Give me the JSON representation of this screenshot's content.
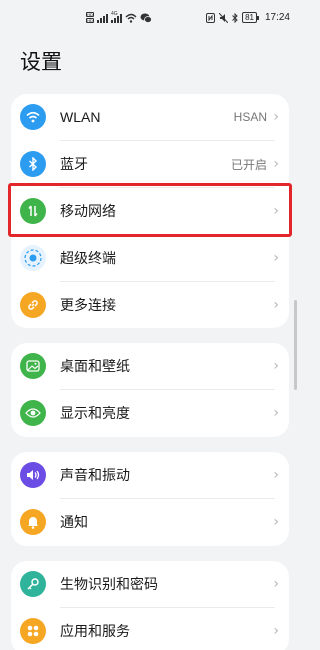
{
  "status_bar": {
    "sim1": "HD",
    "sim2": "HD",
    "net_tag": "4G",
    "battery": "81",
    "time": "17:24"
  },
  "page": {
    "title": "设置"
  },
  "settings": [
    {
      "label": "WLAN",
      "value": "HSAN",
      "icon": "wifi-icon",
      "color": "#2b9cf0"
    },
    {
      "label": "蓝牙",
      "value": "已开启",
      "icon": "bluetooth-icon",
      "color": "#2b9cf0"
    },
    {
      "label": "移动网络",
      "value": "",
      "icon": "mobile-data-icon",
      "color": "#3fb44a"
    },
    {
      "label": "超级终端",
      "value": "",
      "icon": "super-device-icon",
      "color": "#2b9cf0"
    },
    {
      "label": "更多连接",
      "value": "",
      "icon": "link-icon",
      "color": "#f5a623"
    },
    {
      "label": "桌面和壁纸",
      "value": "",
      "icon": "wallpaper-icon",
      "color": "#3fb44a"
    },
    {
      "label": "显示和亮度",
      "value": "",
      "icon": "eye-icon",
      "color": "#3fb44a"
    },
    {
      "label": "声音和振动",
      "value": "",
      "icon": "sound-icon",
      "color": "#6b4de6"
    },
    {
      "label": "通知",
      "value": "",
      "icon": "bell-icon",
      "color": "#f5a623"
    },
    {
      "label": "生物识别和密码",
      "value": "",
      "icon": "key-icon",
      "color": "#2fb39a"
    },
    {
      "label": "应用和服务",
      "value": "",
      "icon": "apps-icon",
      "color": "#f5a623"
    }
  ],
  "highlight_color": "#e3262c"
}
